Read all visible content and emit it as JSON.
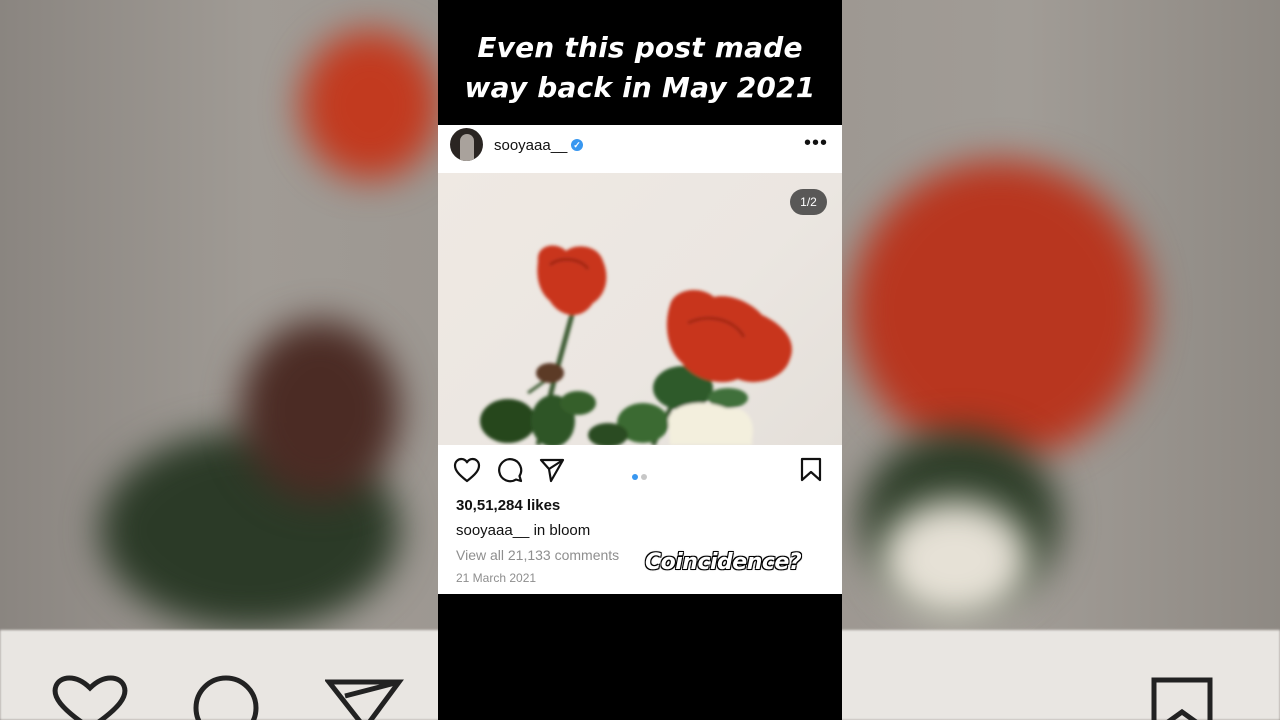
{
  "headline": {
    "line1": "Even this post made",
    "line2": "way back in May 2021"
  },
  "post": {
    "username": "sooyaaa__",
    "verified_icon": "verified-badge-icon",
    "more_icon": "more-options-icon",
    "image_counter": "1/2",
    "carousel": {
      "current": 1,
      "total": 2
    },
    "likes": "30,51,284 likes",
    "caption_user": "sooyaaa__",
    "caption_text": " in bloom",
    "comments_link": "View all 21,133 comments",
    "date": "21 March 2021"
  },
  "overlay": {
    "text": "Coincidence?"
  },
  "actions": {
    "like_icon": "heart-icon",
    "comment_icon": "comment-icon",
    "share_icon": "send-icon",
    "save_icon": "bookmark-icon"
  },
  "colors": {
    "accent": "#3897f0",
    "muted_text": "#8e8e8e",
    "rose": "#c7361e",
    "leaf": "#2f5a2a",
    "frame": "#000000"
  }
}
